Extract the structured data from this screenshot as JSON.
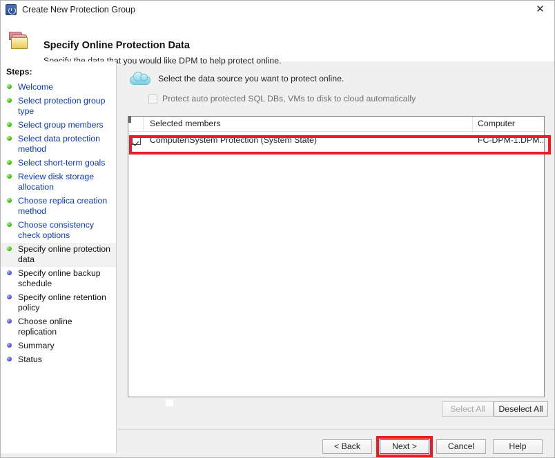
{
  "window": {
    "title": "Create New Protection Group",
    "app_icon": "recovery-clock-icon",
    "close_label": "✕"
  },
  "header": {
    "icon": "folders-icon",
    "title": "Specify Online Protection Data",
    "subtitle": "Specify the data that you would like DPM to help protect online."
  },
  "sidebar": {
    "label": "Steps:",
    "items": [
      {
        "label": "Welcome",
        "state": "done"
      },
      {
        "label": "Select protection group type",
        "state": "done"
      },
      {
        "label": "Select group members",
        "state": "done"
      },
      {
        "label": "Select data protection method",
        "state": "done"
      },
      {
        "label": "Select short-term goals",
        "state": "done"
      },
      {
        "label": "Review disk storage allocation",
        "state": "done"
      },
      {
        "label": "Choose replica creation method",
        "state": "done"
      },
      {
        "label": "Choose consistency check options",
        "state": "done"
      },
      {
        "label": "Specify online protection data",
        "state": "current"
      },
      {
        "label": "Specify online backup schedule",
        "state": "todo"
      },
      {
        "label": "Specify online retention policy",
        "state": "todo"
      },
      {
        "label": "Choose online replication",
        "state": "todo"
      },
      {
        "label": "Summary",
        "state": "todo"
      },
      {
        "label": "Status",
        "state": "todo"
      }
    ]
  },
  "main": {
    "cloud_icon": "cloud-icon",
    "prompt": "Select the data source you want to protect online.",
    "auto_protect": {
      "label": "Protect auto protected SQL DBs, VMs to disk to cloud automatically",
      "checked": false,
      "enabled": false
    },
    "table": {
      "columns": [
        "Selected members",
        "Computer"
      ],
      "rows": [
        {
          "checked": true,
          "selected_member": "Computer\\System Protection (System State)",
          "computer": "FC-DPM-1.DPM..."
        }
      ]
    },
    "select_all_label": "Select All",
    "select_all_enabled": false,
    "deselect_all_label": "Deselect All",
    "deselect_all_enabled": true
  },
  "footer": {
    "back_label": "< Back",
    "next_label": "Next >",
    "cancel_label": "Cancel",
    "help_label": "Help"
  },
  "annotations": {
    "color": "#ED1C24",
    "targets": [
      "selected-member-row",
      "next-button"
    ]
  },
  "colors": {
    "link": "#0B38C6",
    "done_bullet": "#49C61A",
    "todo_bullet": "#5A5EE0",
    "focus_border": "#2D6FB5",
    "dialog_bg": "#F0F0F0"
  }
}
